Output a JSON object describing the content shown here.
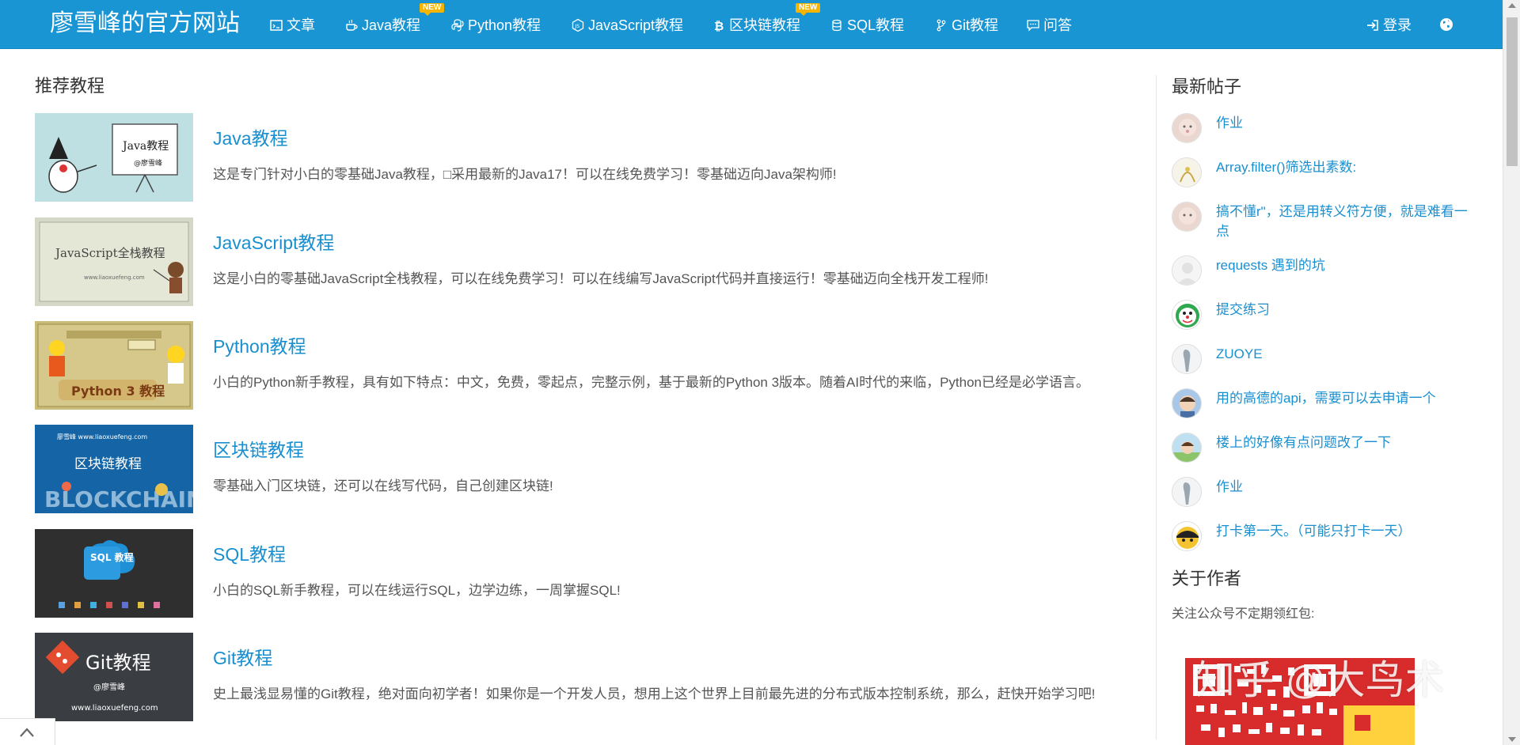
{
  "navbar": {
    "brand": "廖雪峰的官方网站",
    "items": [
      {
        "label": "文章",
        "icon": "article-icon"
      },
      {
        "label": "Java教程",
        "icon": "coffee-icon",
        "badge": "NEW"
      },
      {
        "label": "Python教程",
        "icon": "python-icon"
      },
      {
        "label": "JavaScript教程",
        "icon": "javascript-icon"
      },
      {
        "label": "区块链教程",
        "icon": "bitcoin-icon",
        "badge": "NEW"
      },
      {
        "label": "SQL教程",
        "icon": "database-icon"
      },
      {
        "label": "Git教程",
        "icon": "git-branch-icon"
      },
      {
        "label": "问答",
        "icon": "comment-icon"
      }
    ],
    "login": "登录",
    "login_icon": "sign-in-icon",
    "globe_icon": "globe-icon",
    "bg_color": "#1a95d4"
  },
  "main": {
    "section_title": "推荐教程",
    "courses": [
      {
        "title": "Java教程",
        "desc": "这是专门针对小白的零基础Java教程，□采用最新的Java17！可以在线免费学习！零基础迈向Java架构师!",
        "thumb_text": "Java教程",
        "thumb_sub": "@廖雪峰"
      },
      {
        "title": "JavaScript教程",
        "desc": "这是小白的零基础JavaScript全栈教程，可以在线免费学习！可以在线编写JavaScript代码并直接运行！零基础迈向全栈开发工程师!",
        "thumb_text": "JavaScript全栈教程",
        "thumb_sub": "www.liaoxuefeng.com"
      },
      {
        "title": "Python教程",
        "desc": "小白的Python新手教程，具有如下特点：中文，免费，零起点，完整示例，基于最新的Python 3版本。随着AI时代的来临，Python已经是必学语言。",
        "thumb_text": "Python 3 教程",
        "thumb_sub": ""
      },
      {
        "title": "区块链教程",
        "desc": "零基础入门区块链，还可以在线写代码，自己创建区块链!",
        "thumb_text": "区块链教程",
        "thumb_sub": "廖雪峰 www.liaoxuefeng.com",
        "thumb_big": "BLOCKCHAIN"
      },
      {
        "title": "SQL教程",
        "desc": "小白的SQL新手教程，可以在线运行SQL，边学边练，一周掌握SQL!",
        "thumb_text": "SQL 教程",
        "thumb_sub": ""
      },
      {
        "title": "Git教程",
        "desc": "史上最浅显易懂的Git教程，绝对面向初学者！如果你是一个开发人员，想用上这个世界上目前最先进的分布式版本控制系统，那么，赶快开始学习吧!",
        "thumb_text": "Git教程",
        "thumb_sub": "@廖雪峰",
        "thumb_url": "www.liaoxuefeng.com"
      }
    ]
  },
  "sidebar": {
    "latest_title": "最新帖子",
    "posts": [
      {
        "text": "作业"
      },
      {
        "text": "Array.filter()筛选出素数:"
      },
      {
        "text": "搞不懂r\"，还是用转义符方便，就是难看一点"
      },
      {
        "text": "requests 遇到的坑"
      },
      {
        "text": "提交练习"
      },
      {
        "text": "ZUOYE"
      },
      {
        "text": "用的高德的api，需要可以去申请一个"
      },
      {
        "text": "楼上的好像有点问题改了一下"
      },
      {
        "text": "作业"
      },
      {
        "text": "打卡第一天。（可能只打卡一天）"
      }
    ],
    "about_title": "关于作者",
    "about_text": "关注公众号不定期领红包:",
    "watermark": "知乎 @大鸟术"
  },
  "ui": {
    "back_to_top_icon": "chevron-up-icon",
    "link_color": "#1a8fd0"
  }
}
